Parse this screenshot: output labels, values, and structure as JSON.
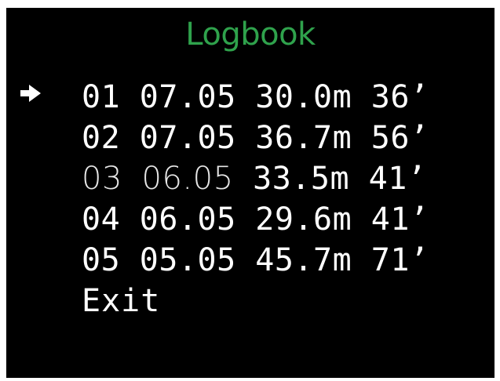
{
  "screen": {
    "title": "Logbook",
    "title_color": "#2fa24c",
    "background": "#000000",
    "text_color": "#ffffff"
  },
  "logbook": {
    "selected_index": 0,
    "cursor_icon": "arrow-right-icon",
    "entries": [
      {
        "num": "01",
        "date": "07.05",
        "depth": "30.0m",
        "duration": "36’"
      },
      {
        "num": "02",
        "date": "07.05",
        "depth": "36.7m",
        "duration": "56’"
      },
      {
        "num": "03",
        "date": "06.05",
        "depth": "33.5m",
        "duration": "41’"
      },
      {
        "num": "04",
        "date": "06.05",
        "depth": "29.6m",
        "duration": "41’"
      },
      {
        "num": "05",
        "date": "05.05",
        "depth": "45.7m",
        "duration": "71’"
      }
    ],
    "exit_label": "Exit"
  }
}
